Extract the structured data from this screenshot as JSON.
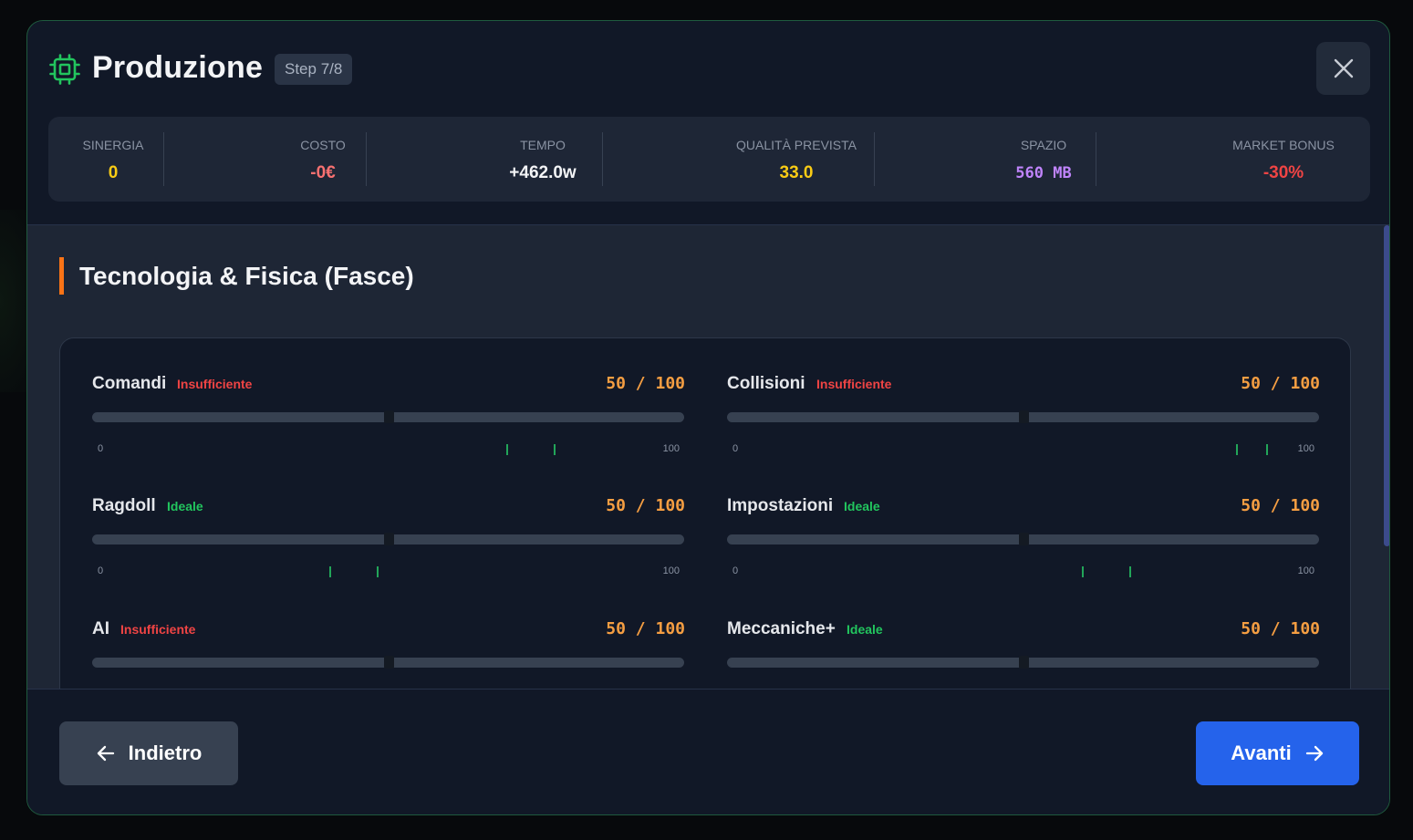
{
  "header": {
    "icon": "chip-icon",
    "title": "Produzione",
    "step": "Step 7/8",
    "close_icon": "close-icon"
  },
  "stats": [
    {
      "label": "SINERGIA",
      "value": "0",
      "color": "#facc15"
    },
    {
      "label": "COSTO",
      "value": "-0€",
      "color": "#f87171"
    },
    {
      "label": "TEMPO",
      "value": "+462.0w",
      "color": "#f3f4f6"
    },
    {
      "label": "QUALITÀ PREVISTA",
      "value": "33.0",
      "color": "#facc15"
    },
    {
      "label": "SPAZIO",
      "value": "560 MB",
      "color": "#c084fc"
    },
    {
      "label": "MARKET BONUS",
      "value": "-30%",
      "color": "#ef4444"
    }
  ],
  "section": {
    "title": "Tecnologia & Fisica (Fasce)"
  },
  "params": [
    {
      "name": "Comandi",
      "status": "Insufficiente",
      "status_color": "#ef4444",
      "value": "50 / 100",
      "level": 50,
      "min": "0",
      "max": "100",
      "ideal_range": [
        70,
        78
      ]
    },
    {
      "name": "Collisioni",
      "status": "Insufficiente",
      "status_color": "#ef4444",
      "value": "50 / 100",
      "level": 50,
      "min": "0",
      "max": "100",
      "ideal_range": [
        86,
        91
      ]
    },
    {
      "name": "Ragdoll",
      "status": "Ideale",
      "status_color": "#22c55e",
      "value": "50 / 100",
      "level": 50,
      "min": "0",
      "max": "100",
      "ideal_range": [
        40,
        48
      ]
    },
    {
      "name": "Impostazioni",
      "status": "Ideale",
      "status_color": "#22c55e",
      "value": "50 / 100",
      "level": 50,
      "min": "0",
      "max": "100",
      "ideal_range": [
        60,
        68
      ]
    },
    {
      "name": "AI",
      "status": "Insufficiente",
      "status_color": "#ef4444",
      "value": "50 / 100",
      "level": 50,
      "min": "0",
      "max": "100",
      "ideal_range": null
    },
    {
      "name": "Meccaniche+",
      "status": "Ideale",
      "status_color": "#22c55e",
      "value": "50 / 100",
      "level": 50,
      "min": "0",
      "max": "100",
      "ideal_range": null
    }
  ],
  "footer": {
    "back_label": "Indietro",
    "back_icon": "arrow-left-icon",
    "next_label": "Avanti",
    "next_icon": "arrow-right-icon"
  }
}
